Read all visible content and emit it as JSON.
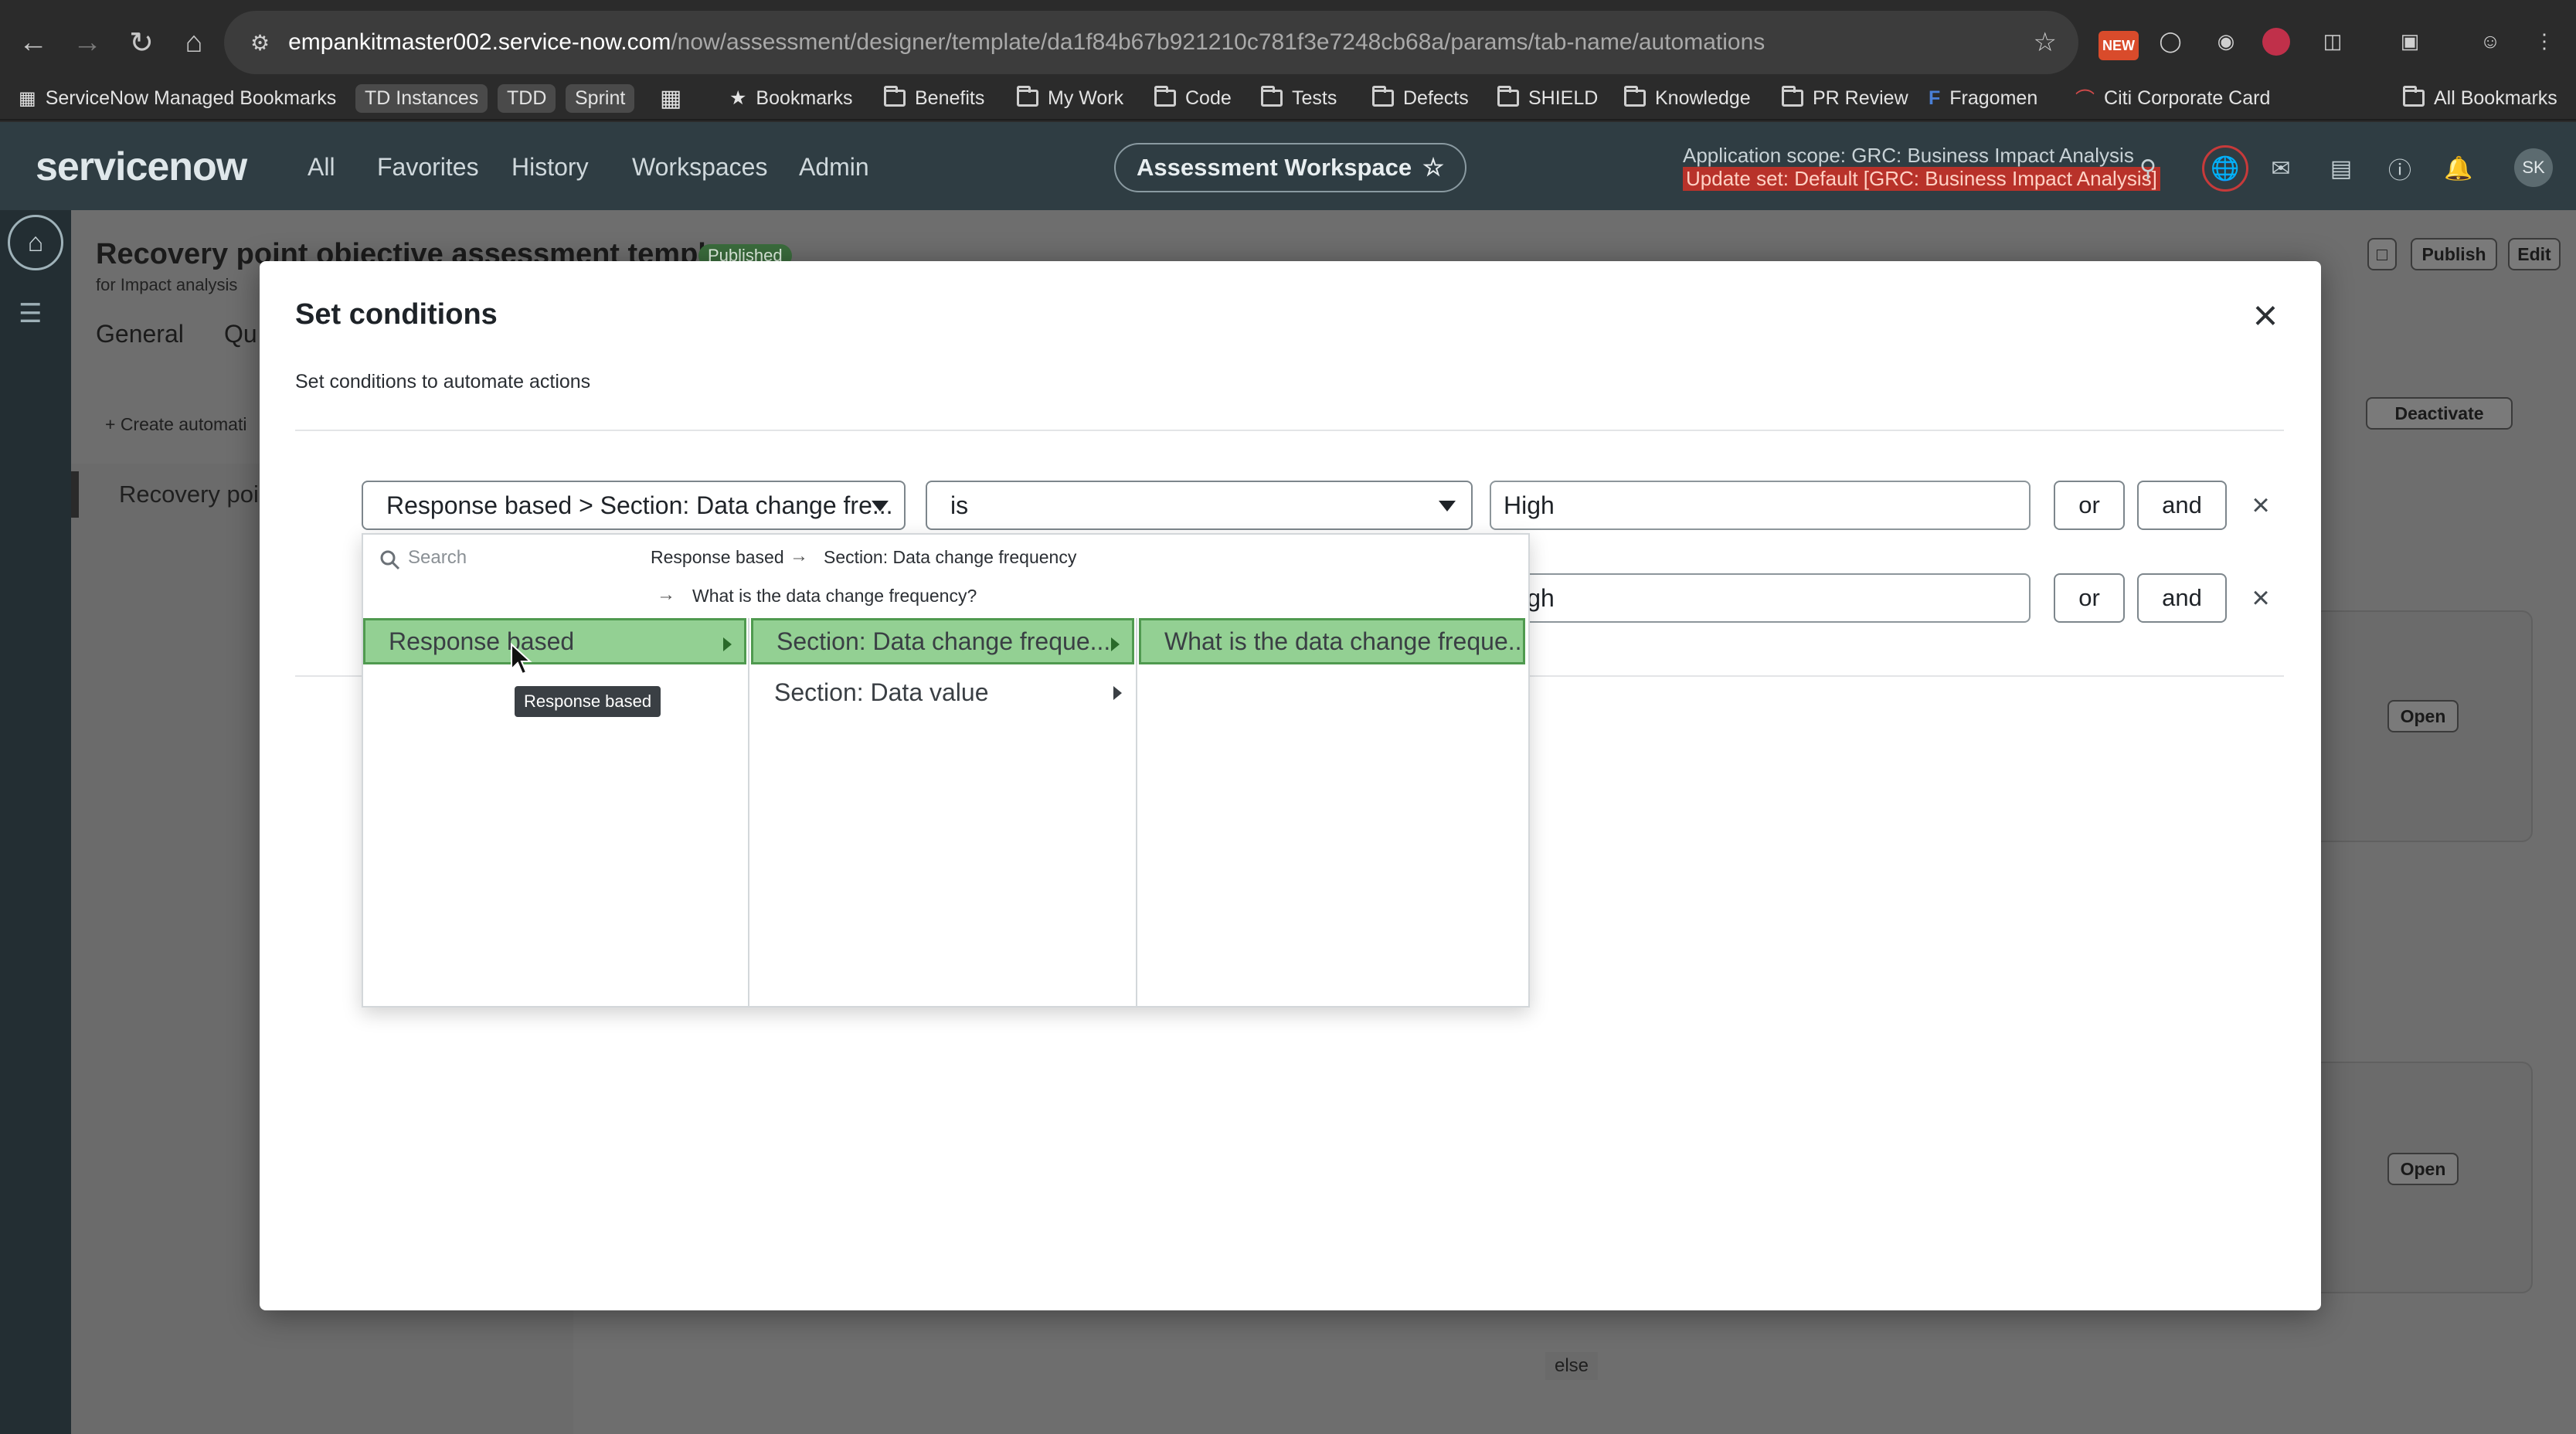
{
  "browser": {
    "url_host": "empankitmaster002.service-now.com",
    "url_path": "/now/assessment/designer/template/da1f84b67b921210c781f3e7248cb68a/params/tab-name/automations",
    "extension_badge": "NEW",
    "bookmarks": [
      {
        "label": "ServiceNow Managed Bookmarks",
        "icon": "managed-bookmarks-icon"
      },
      {
        "label": "TD Instances",
        "icon": "none"
      },
      {
        "label": "TDD",
        "icon": "none"
      },
      {
        "label": "Sprint",
        "icon": "none"
      },
      {
        "label": "Bookmarks",
        "icon": "star-icon"
      },
      {
        "label": "Benefits",
        "icon": "folder-icon"
      },
      {
        "label": "My Work",
        "icon": "folder-icon"
      },
      {
        "label": "Code",
        "icon": "folder-icon"
      },
      {
        "label": "Tests",
        "icon": "folder-icon"
      },
      {
        "label": "Defects",
        "icon": "folder-icon"
      },
      {
        "label": "SHIELD",
        "icon": "folder-icon"
      },
      {
        "label": "Knowledge",
        "icon": "folder-icon"
      },
      {
        "label": "PR Review",
        "icon": "folder-icon"
      },
      {
        "label": "Fragomen",
        "icon": "fragomen-icon"
      },
      {
        "label": "Citi Corporate Card",
        "icon": "citi-icon"
      },
      {
        "label": "All Bookmarks",
        "icon": "folder-icon"
      }
    ]
  },
  "header": {
    "logo": "servicenow",
    "nav": [
      "All",
      "Favorites",
      "History",
      "Workspaces",
      "Admin"
    ],
    "workspace": "Assessment Workspace",
    "scope_line1": "Application scope: GRC: Business Impact Analysis",
    "scope_line2": "Update set: Default [GRC: Business Impact Analysis]",
    "avatar_initials": "SK"
  },
  "background_page": {
    "title": "Recovery point objective assessment template",
    "status_badge": "Published",
    "subtitle": "for Impact analysis",
    "tabs": [
      "General",
      "Qu"
    ],
    "create_automation": "+ Create automati",
    "list_item": "Recovery poi",
    "publish_label": "Publish",
    "edit_label": "Edit",
    "deactivate_label": "Deactivate",
    "open_label": "Open",
    "else_label": "else"
  },
  "modal": {
    "title": "Set conditions",
    "description": "Set conditions to automate actions",
    "conditions": [
      {
        "field": "Response based > Section: Data change fre...",
        "operator": "is",
        "value": "High",
        "or_label": "or",
        "and_label": "and"
      },
      {
        "field": "",
        "operator": "",
        "value": "High",
        "or_label": "or",
        "and_label": "and"
      }
    ]
  },
  "cascade": {
    "search_placeholder": "Search",
    "breadcrumb": [
      "Response based",
      "Section: Data change frequency",
      "What is the data change frequency?"
    ],
    "col1": [
      {
        "label": "Response based",
        "selected": true,
        "has_children": true
      }
    ],
    "col2": [
      {
        "label": "Section: Data change freque...",
        "selected": true,
        "has_children": true
      },
      {
        "label": "Section: Data value",
        "selected": false,
        "has_children": true
      }
    ],
    "col3": [
      {
        "label": "What is the data change freque...",
        "selected": true,
        "has_children": false
      }
    ],
    "tooltip": "Response based"
  },
  "colors": {
    "sn_header": "#2f3d43",
    "selected_option": "#93d093",
    "selected_border": "#4f9a4f",
    "scope_alert": "#b8322a"
  }
}
